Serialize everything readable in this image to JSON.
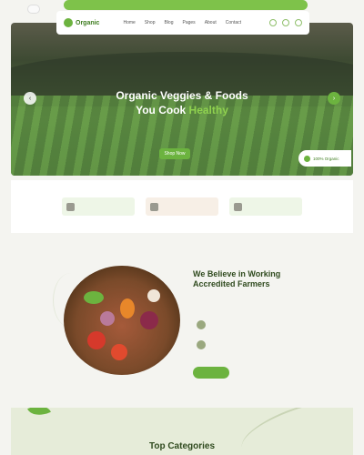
{
  "topbar": {
    "left_text": "",
    "right_text": ""
  },
  "header": {
    "logo_text": "Organic",
    "nav": [
      "Home",
      "Shop",
      "Blog",
      "Pages",
      "About",
      "Contact"
    ]
  },
  "hero": {
    "title_line1": "Organic Veggies & Foods",
    "title_line2": "You Cook",
    "title_accent": "Healthy",
    "cta_label": "Shop Now",
    "badge_text": "100% Organic"
  },
  "features": [
    {
      "label": ""
    },
    {
      "label": ""
    },
    {
      "label": ""
    }
  ],
  "about": {
    "title": "We Believe in Working Accredited Farmers",
    "text": "",
    "items": [
      {
        "title": "",
        "desc": ""
      },
      {
        "title": "",
        "desc": ""
      }
    ],
    "button_label": ""
  },
  "categories": {
    "kicker": "",
    "title": "Top Categories"
  },
  "colors": {
    "accent": "#6cb33f",
    "dark_green": "#2f4a1e",
    "topbar": "#7ec24a"
  }
}
